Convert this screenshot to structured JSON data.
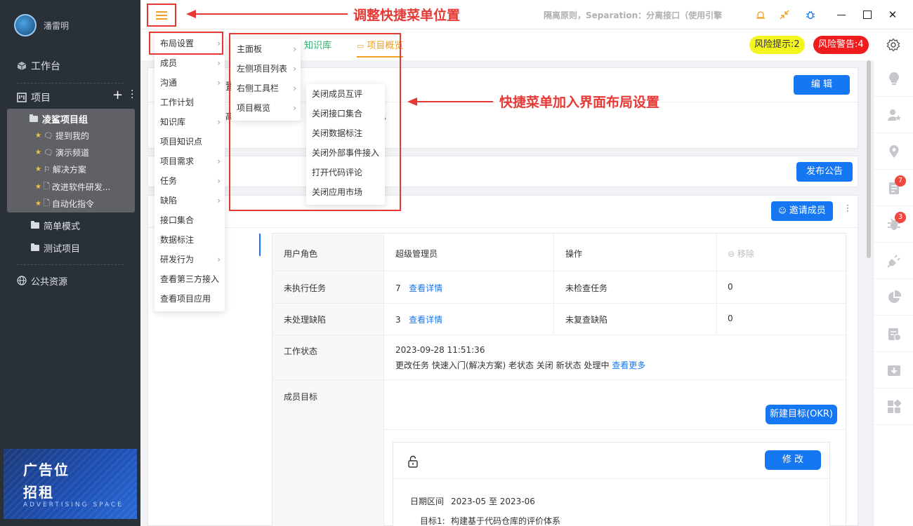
{
  "sidebar": {
    "username": "潘雷明",
    "workbench": "工作台",
    "projects": "项目",
    "project_group": "凌鲨项目组",
    "group_items": [
      {
        "label": "提到我的",
        "icon": "chat-icon"
      },
      {
        "label": "演示频道",
        "icon": "chat-icon"
      },
      {
        "label": "解决方案",
        "icon": "flag-icon"
      },
      {
        "label": "改进软件研发...",
        "icon": "doc-icon"
      },
      {
        "label": "自动化指令",
        "icon": "doc-icon"
      }
    ],
    "other_projects": [
      "简单模式",
      "测试项目"
    ],
    "public_resources": "公共资源",
    "ad": {
      "line1": "广告位",
      "line2": "招租",
      "line3": "ADVERTISING SPACE"
    }
  },
  "topbar": {
    "principle": "隔离原则，Separation：分离接口（使用引擎",
    "annotation_menu": "调整快捷菜单位置",
    "annotation_layout": "快捷菜单加入界面布局设置"
  },
  "tabs": {
    "knowledge": "知识库",
    "overview": "项目概览"
  },
  "risk": {
    "hint": "风险提示:2",
    "warning": "风险警告:4"
  },
  "cards": {
    "edit": "编 辑",
    "fragment_1": "置",
    "fragment_2": "高",
    "fragment_3": "。",
    "publish": "发布公告",
    "invite": "邀请成员"
  },
  "info": {
    "role_label": "用户角色",
    "role_value": "超级管理员",
    "op_label": "操作",
    "remove": "移除",
    "undone_tasks_label": "未执行任务",
    "undone_tasks_count": "7",
    "view_detail": "查看详情",
    "unchecked_tasks_label": "未检查任务",
    "unchecked_tasks_count": "0",
    "unhandled_bugs_label": "未处理缺陷",
    "unhandled_bugs_count": "3",
    "unrechecked_bugs_label": "未复查缺陷",
    "unrechecked_bugs_count": "0",
    "work_status_label": "工作状态",
    "work_status_time": "2023-09-28 11:51:36",
    "work_status_text": "更改任务 快速入门(解决方案) 老状态 关闭 新状态 处理中",
    "view_more": "查看更多",
    "goal_label": "成员目标",
    "new_goal": "新建目标(OKR)",
    "modify": "修 改",
    "date_label": "日期区间",
    "date_value": "2023-05 至 2023-06",
    "goal1_label": "目标1:",
    "goal1_value": "构建基于代码仓库的评价体系"
  },
  "rail_badges": {
    "doc": "7",
    "bug": "3"
  },
  "menu1": [
    {
      "label": "布局设置",
      "arrow": true
    },
    {
      "label": "成员",
      "arrow": true
    },
    {
      "label": "沟通",
      "arrow": true
    },
    {
      "label": "工作计划",
      "arrow": false
    },
    {
      "label": "知识库",
      "arrow": true
    },
    {
      "label": "项目知识点",
      "arrow": false
    },
    {
      "label": "项目需求",
      "arrow": true
    },
    {
      "label": "任务",
      "arrow": true
    },
    {
      "label": "缺陷",
      "arrow": true
    },
    {
      "label": "接口集合",
      "arrow": false
    },
    {
      "label": "数据标注",
      "arrow": false
    },
    {
      "label": "研发行为",
      "arrow": true
    },
    {
      "label": "查看第三方接入",
      "arrow": false
    },
    {
      "label": "查看项目应用",
      "arrow": false
    }
  ],
  "menu2": [
    {
      "label": "主面板",
      "arrow": true
    },
    {
      "label": "左侧项目列表",
      "arrow": true
    },
    {
      "label": "右侧工具栏",
      "arrow": true
    },
    {
      "label": "项目概览",
      "arrow": true
    }
  ],
  "menu3": [
    {
      "label": "关闭成员互评"
    },
    {
      "label": "关闭接口集合"
    },
    {
      "label": "关闭数据标注"
    },
    {
      "label": "关闭外部事件接入"
    },
    {
      "label": "打开代码评论"
    },
    {
      "label": "关闭应用市场"
    }
  ],
  "colors": {
    "accent": "#1677f2",
    "annotation": "#e53935",
    "sidebar": "#2a3038",
    "risk_hint": "#f5f51e",
    "risk_warning": "#ee1c1c"
  }
}
